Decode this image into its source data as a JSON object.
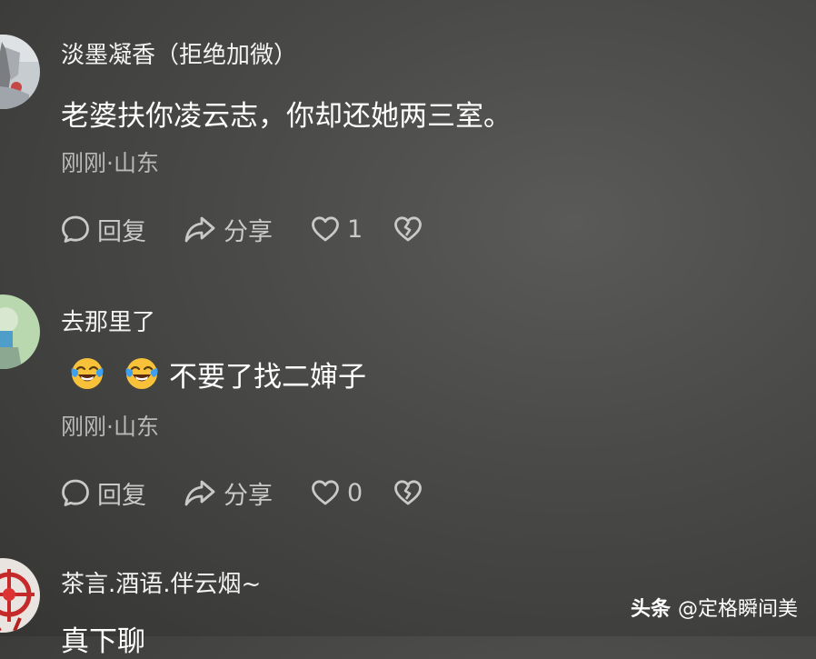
{
  "comments": [
    {
      "username": "淡墨凝香（拒绝加微）",
      "text": "老婆扶你凌云志，你却还她两三室。",
      "meta": "刚刚·山东",
      "reply_label": "回复",
      "share_label": "分享",
      "like_count": "1"
    },
    {
      "username": "去那里了",
      "emojis": [
        "laugh-cry-emoji",
        "laugh-cry-emoji"
      ],
      "text": "不要了找二婶子",
      "meta": "刚刚·山东",
      "reply_label": "回复",
      "share_label": "分享",
      "like_count": "0"
    },
    {
      "username": "茶言.酒语.伴云烟~",
      "text": "真下聊"
    }
  ],
  "watermark": {
    "brand": "头条",
    "handle": "@定格瞬间美"
  },
  "colors": {
    "background": "#474745",
    "text_primary": "#ffffff",
    "text_secondary": "#b9b9b7",
    "icon": "#c9c9c7",
    "emoji_face": "#f7c23a",
    "emoji_tears": "#3ea0f0"
  },
  "icons": {
    "reply": "speech-bubble-icon",
    "share": "share-arrow-icon",
    "like": "heart-icon",
    "dislike": "broken-heart-icon"
  }
}
